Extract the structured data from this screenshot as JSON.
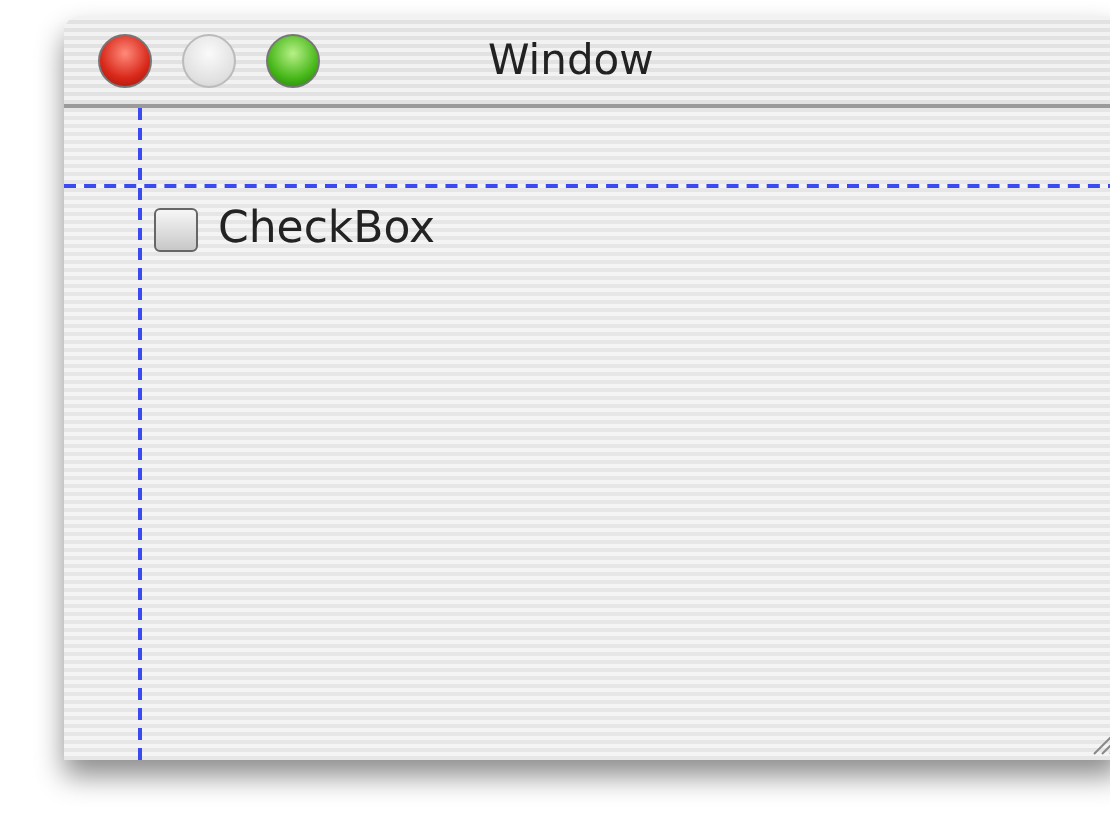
{
  "window": {
    "title": "Window",
    "buttons": [
      {
        "kind": "close",
        "disabled": false
      },
      {
        "kind": "minimize",
        "disabled": true
      },
      {
        "kind": "zoom",
        "disabled": false
      }
    ]
  },
  "checkbox": {
    "label": "CheckBox",
    "checked": false
  }
}
